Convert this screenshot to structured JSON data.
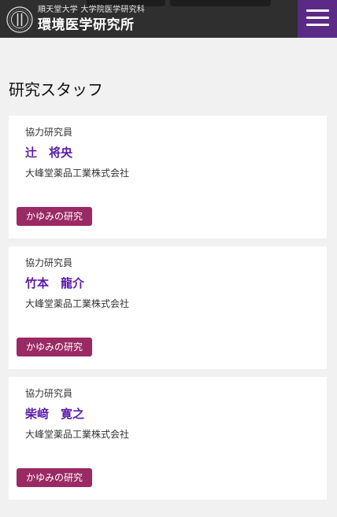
{
  "header": {
    "university": "順天堂大学 大学院医学研究科",
    "institute": "環境医学研究所"
  },
  "section": {
    "title": "研究スタッフ"
  },
  "staff": [
    {
      "role": "協力研究員",
      "name": "辻　将央",
      "affiliation": "大峰堂薬品工業株式会社",
      "tag": "かゆみの研究"
    },
    {
      "role": "協力研究員",
      "name": "竹本　龍介",
      "affiliation": "大峰堂薬品工業株式会社",
      "tag": "かゆみの研究"
    },
    {
      "role": "協力研究員",
      "name": "柴﨑　寛之",
      "affiliation": "大峰堂薬品工業株式会社",
      "tag": "かゆみの研究"
    }
  ],
  "colors": {
    "header_bg": "#2f2f2f",
    "menu_bg": "#5a2a86",
    "name_text": "#5a1aa8",
    "tag_bg": "#9a2a63"
  }
}
